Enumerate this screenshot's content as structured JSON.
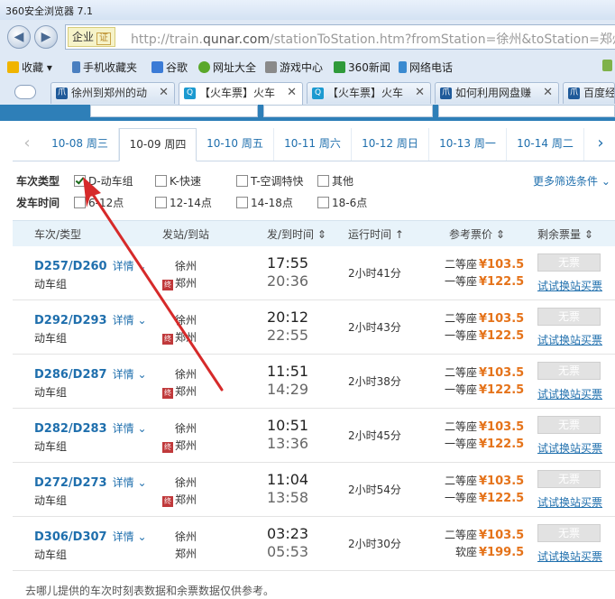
{
  "browser": {
    "title": "360安全浏览器 7.1",
    "site_badge": "企业",
    "site_badge_ev": "证",
    "url_prefix": "http://train.",
    "url_domain": "qunar.com",
    "url_rest": "/stationToStation.htm?fromStation=徐州&toStation=郑州",
    "bookmarks": [
      {
        "label": "收藏",
        "icon": "star-icon"
      },
      {
        "label": "手机收藏夹",
        "icon": "phone-icon"
      },
      {
        "label": "谷歌",
        "icon": "google-icon"
      },
      {
        "label": "网址大全",
        "icon": "web-directory-icon"
      },
      {
        "label": "游戏中心",
        "icon": "gamepad-icon"
      },
      {
        "label": "360新闻",
        "icon": "news-icon"
      },
      {
        "label": "网络电话",
        "icon": "phone-call-icon"
      }
    ],
    "tabs": [
      {
        "label": "徐州到郑州的动"
      },
      {
        "label": "【火车票】火车"
      },
      {
        "label": "【火车票】火车"
      },
      {
        "label": "如何利用网盘赚"
      },
      {
        "label": "百度经"
      }
    ]
  },
  "dates": [
    "10-08 周三",
    "10-09 周四",
    "10-10 周五",
    "10-11 周六",
    "10-12 周日",
    "10-13 周一",
    "10-14 周二"
  ],
  "filters": {
    "type_label": "车次类型",
    "types": [
      {
        "label": "D-动车组",
        "checked": true
      },
      {
        "label": "K-快速",
        "checked": false
      },
      {
        "label": "T-空调特快",
        "checked": false
      },
      {
        "label": "其他",
        "checked": false
      }
    ],
    "more": "更多筛选条件",
    "time_label": "发车时间",
    "times": [
      "6-12点",
      "12-14点",
      "14-18点",
      "18-6点"
    ]
  },
  "table_header": [
    "车次/类型",
    "发站/到站",
    "发/到时间",
    "运行时间",
    "参考票价",
    "剩余票量"
  ],
  "trains": [
    {
      "code": "D257/D260",
      "detail": "详情",
      "type": "动车组",
      "from": "徐州",
      "to": "郑州",
      "dep": "17:55",
      "arr": "20:36",
      "duration": "2小时41分",
      "seat1": "二等座",
      "price1": "¥103.5",
      "seat2": "一等座",
      "price2": "¥122.5",
      "status": "无票",
      "transfer": "试试换站买票"
    },
    {
      "code": "D292/D293",
      "detail": "详情",
      "type": "动车组",
      "from": "徐州",
      "to": "郑州",
      "dep": "20:12",
      "arr": "22:55",
      "duration": "2小时43分",
      "seat1": "二等座",
      "price1": "¥103.5",
      "seat2": "一等座",
      "price2": "¥122.5",
      "status": "无票",
      "transfer": "试试换站买票"
    },
    {
      "code": "D286/D287",
      "detail": "详情",
      "type": "动车组",
      "from": "徐州",
      "to": "郑州",
      "dep": "11:51",
      "arr": "14:29",
      "duration": "2小时38分",
      "seat1": "二等座",
      "price1": "¥103.5",
      "seat2": "一等座",
      "price2": "¥122.5",
      "status": "无票",
      "transfer": "试试换站买票"
    },
    {
      "code": "D282/D283",
      "detail": "详情",
      "type": "动车组",
      "from": "徐州",
      "to": "郑州",
      "dep": "10:51",
      "arr": "13:36",
      "duration": "2小时45分",
      "seat1": "二等座",
      "price1": "¥103.5",
      "seat2": "一等座",
      "price2": "¥122.5",
      "status": "无票",
      "transfer": "试试换站买票"
    },
    {
      "code": "D272/D273",
      "detail": "详情",
      "type": "动车组",
      "from": "徐州",
      "to": "郑州",
      "dep": "11:04",
      "arr": "13:58",
      "duration": "2小时54分",
      "seat1": "二等座",
      "price1": "¥103.5",
      "seat2": "一等座",
      "price2": "¥122.5",
      "status": "无票",
      "transfer": "试试换站买票"
    },
    {
      "code": "D306/D307",
      "detail": "详情",
      "type": "动车组",
      "from": "徐州",
      "to": "郑州",
      "dep": "03:23",
      "arr": "05:53",
      "duration": "2小时30分",
      "seat1": "二等座",
      "price1": "¥103.5",
      "seat2": "软座",
      "price2": "¥199.5",
      "status": "无票",
      "transfer": "试试换站买票"
    }
  ],
  "footnote": "去哪儿提供的车次时刻表数据和余票数据仅供参考。",
  "colors": {
    "accent": "#1f6fad",
    "price": "#e5731a",
    "annotation": "#d62a2a"
  }
}
